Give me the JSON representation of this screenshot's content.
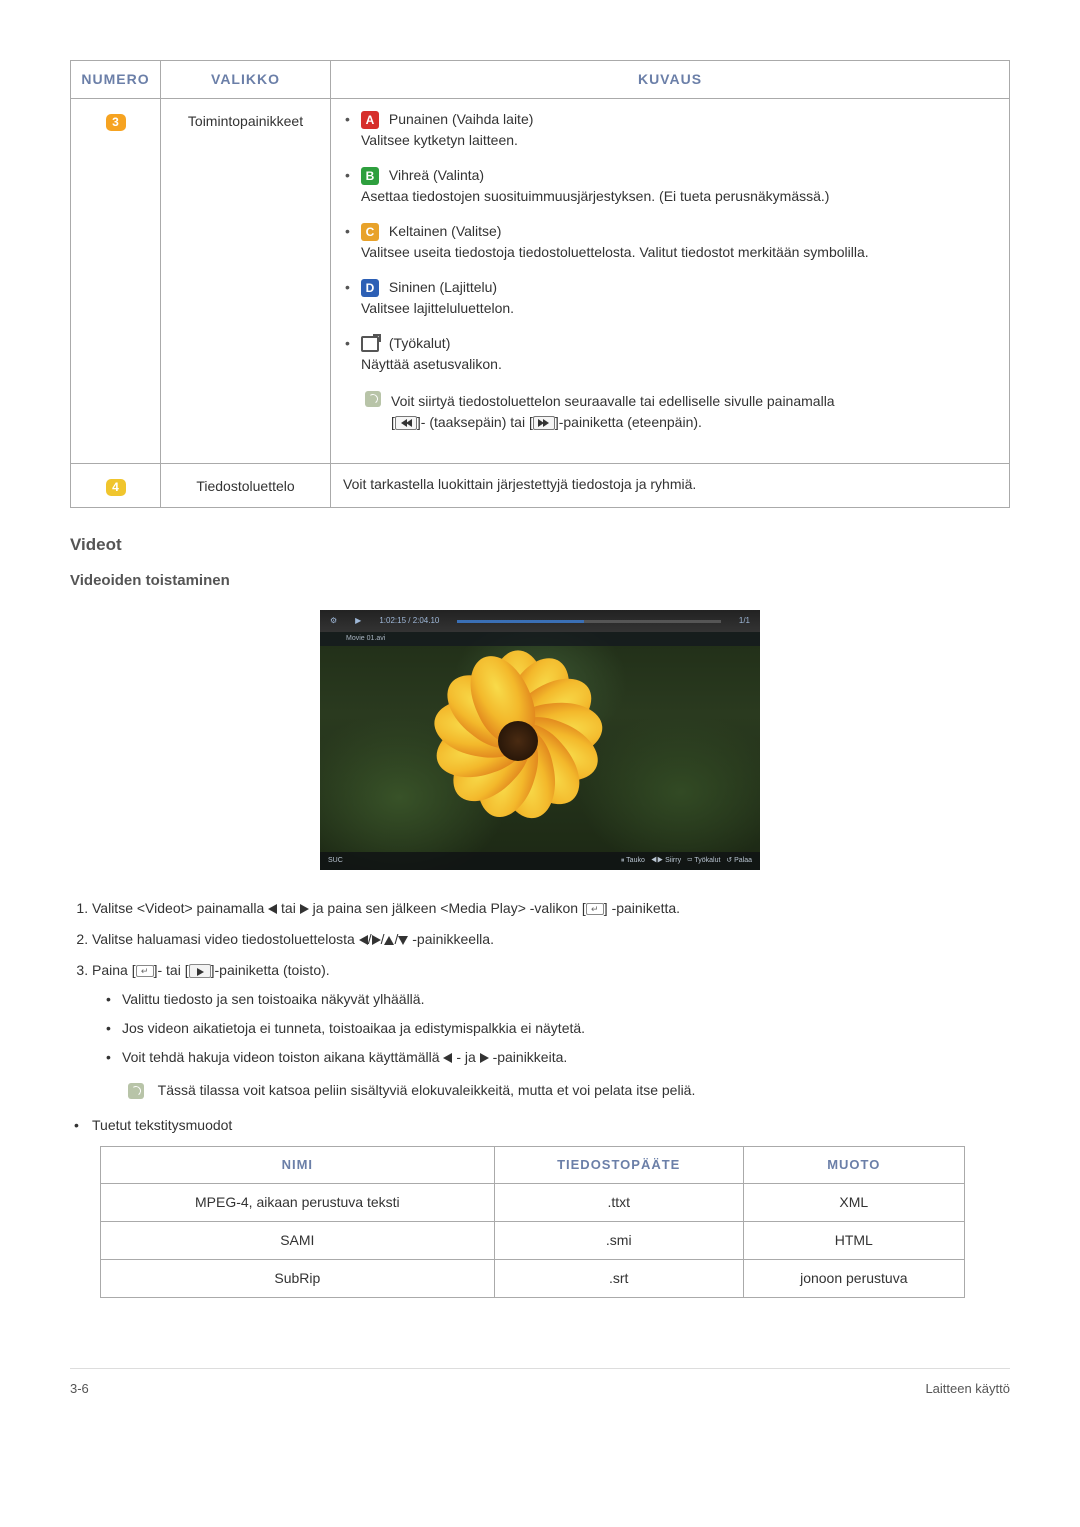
{
  "table": {
    "headers": {
      "num": "NUMERO",
      "menu": "VALIKKO",
      "desc": "KUVAUS"
    },
    "row3": {
      "num": "3",
      "menu": "Toimintopainikkeet",
      "red_label": "Punainen (Vaihda laite)",
      "red_desc": "Valitsee kytketyn laitteen.",
      "green_label": "Vihreä (Valinta)",
      "green_desc": "Asettaa tiedostojen suosituimmuusjärjestyksen. (Ei tueta perusnäkymässä.)",
      "yellow_label": "Keltainen (Valitse)",
      "yellow_desc": "Valitsee useita tiedostoja tiedostoluettelosta. Valitut tiedostot merkitään symbolilla.",
      "blue_label": "Sininen (Lajittelu)",
      "blue_desc": "Valitsee lajitteluluettelon.",
      "tools_label": "(Työkalut)",
      "tools_desc": "Näyttää asetusvalikon.",
      "note_a": "Voit siirtyä tiedostoluettelon seuraavalle tai edelliselle sivulle painamalla",
      "note_b1": "]- (taaksepäin) tai [",
      "note_b2": "]-painiketta (eteenpäin)."
    },
    "row4": {
      "num": "4",
      "menu": "Tiedostoluettelo",
      "desc": "Voit tarkastella luokittain järjestettyjä tiedostoja ja ryhmiä."
    }
  },
  "heading_videos": "Videot",
  "heading_playback": "Videoiden toistaminen",
  "player": {
    "time": "1:02:15 / 2:04.10",
    "page": "1/1",
    "filename": "Movie 01.avi",
    "left_label": "SUC",
    "ctrl_pause": "Tauko",
    "ctrl_move": "Siirry",
    "ctrl_tools": "Työkalut",
    "ctrl_return": "Palaa"
  },
  "steps": {
    "s1a": "Valitse <Videot> painamalla ",
    "s1b": " tai ",
    "s1c": " ja paina sen jälkeen <Media Play> -valikon [",
    "s1d": "] -painiketta.",
    "s2a": "Valitse haluamasi video tiedostoluettelosta ",
    "s2b": "-painikkeella.",
    "s3a": "Paina [",
    "s3b": "]- tai [",
    "s3c": "]-painiketta (toisto).",
    "s3_1": "Valittu tiedosto ja sen toistoaika näkyvät ylhäällä.",
    "s3_2": "Jos videon aikatietoja ei tunneta, toistoaikaa ja edistymispalkkia ei näytetä.",
    "s3_3a": "Voit tehdä hakuja videon toiston aikana käyttämällä ",
    "s3_3b": "- ja ",
    "s3_3c": "-painikkeita."
  },
  "note2": "Tässä tilassa voit katsoa peliin sisältyviä elokuvaleikkeitä, mutta et voi pelata itse peliä.",
  "supported_label": "Tuetut tekstitysmuodot",
  "fmt_table": {
    "headers": {
      "name": "NIMI",
      "ext": "TIEDOSTOPÄÄTE",
      "format": "MUOTO"
    },
    "rows": [
      {
        "name": "MPEG-4, aikaan perustuva teksti",
        "ext": ".ttxt",
        "format": "XML"
      },
      {
        "name": "SAMI",
        "ext": ".smi",
        "format": "HTML"
      },
      {
        "name": "SubRip",
        "ext": ".srt",
        "format": "jonoon perustuva"
      }
    ]
  },
  "footer": {
    "left": "3-6",
    "right": "Laitteen käyttö"
  },
  "glyphs": {
    "A": "A",
    "B": "B",
    "C": "C",
    "D": "D"
  }
}
